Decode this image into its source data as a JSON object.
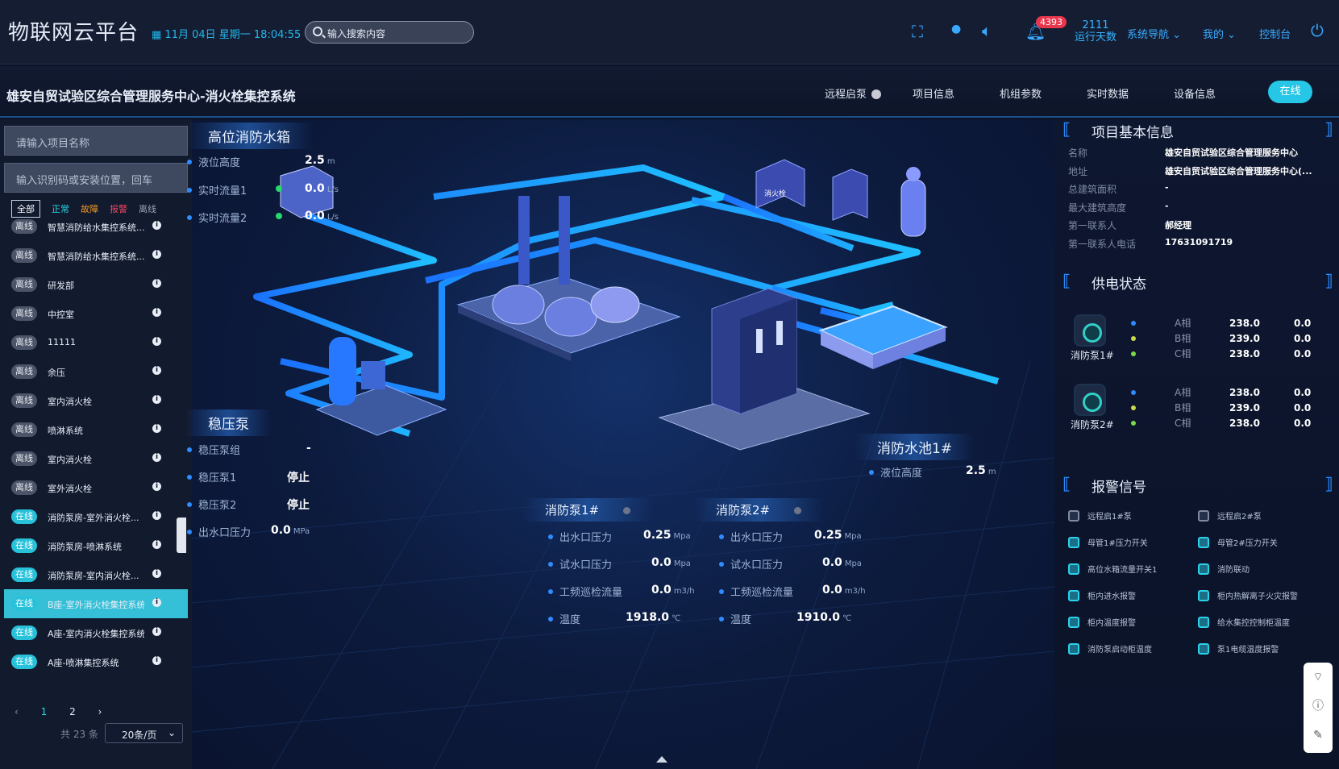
{
  "header": {
    "brand": "物联网云平台",
    "datetime": "11月 04日 星期一 18:04:55",
    "search_placeholder": "输入搜索内容",
    "notif_count": "4393",
    "run_days_value": "2111",
    "run_days_label": "运行天数",
    "nav_system": "系统导航",
    "nav_mine": "我的",
    "nav_console": "控制台"
  },
  "titlebar": {
    "system_title": "雄安自贸试验区综合管理服务中心-消火栓集控系统",
    "remote_start": "远程启泵",
    "tabs": [
      "项目信息",
      "机组参数",
      "实时数据",
      "设备信息"
    ],
    "online": "在线"
  },
  "sidebar": {
    "project_input": "请输入项目名称",
    "code_input": "输入识别码或安装位置，回车",
    "filters": [
      "全部",
      "正常",
      "故障",
      "报警",
      "离线"
    ],
    "items": [
      {
        "status": "离线",
        "name": "智慧消防给水集控系统..."
      },
      {
        "status": "离线",
        "name": "智慧消防给水集控系统..."
      },
      {
        "status": "离线",
        "name": "研发部"
      },
      {
        "status": "离线",
        "name": "中控室"
      },
      {
        "status": "离线",
        "name": "11111"
      },
      {
        "status": "离线",
        "name": "余压"
      },
      {
        "status": "离线",
        "name": "室内消火栓"
      },
      {
        "status": "离线",
        "name": "喷淋系统"
      },
      {
        "status": "离线",
        "name": "室内消火栓"
      },
      {
        "status": "离线",
        "name": "室外消火栓"
      },
      {
        "status": "在线",
        "name": "消防泵房-室外消火栓..."
      },
      {
        "status": "在线",
        "name": "消防泵房-喷淋系统"
      },
      {
        "status": "在线",
        "name": "消防泵房-室内消火栓..."
      },
      {
        "status": "在线",
        "name": "B座-室外消火栓集控系统"
      },
      {
        "status": "在线",
        "name": "A座-室内消火栓集控系统"
      },
      {
        "status": "在线",
        "name": "A座-喷淋集控系统"
      }
    ],
    "selected_index": 13,
    "pager": {
      "page1": "1",
      "page2": "2",
      "total": "共 23 条",
      "page_size": "20条/页"
    }
  },
  "scene": {
    "tank": {
      "title": "高位消防水箱",
      "level_label": "液位高度",
      "level_value": "2.5",
      "level_unit": "m",
      "flow1_label": "实时流量1",
      "flow1_value": "0.0",
      "flow1_unit": "L/s",
      "flow2_label": "实时流量2",
      "flow2_value": "0.0",
      "flow2_unit": "L/s"
    },
    "regulator": {
      "title": "稳压泵",
      "group_label": "稳压泵组",
      "group_value": "-",
      "p1_label": "稳压泵1",
      "p1_value": "停止",
      "p2_label": "稳压泵2",
      "p2_value": "停止",
      "outlet_label": "出水口压力",
      "outlet_value": "0.0",
      "outlet_unit": "MPa"
    },
    "pool": {
      "title": "消防水池1#",
      "level_label": "液位高度",
      "level_value": "2.5",
      "level_unit": "m"
    },
    "pump1": {
      "title": "消防泵1#",
      "rows": [
        [
          "出水口压力",
          "0.25",
          "Mpa"
        ],
        [
          "试水口压力",
          "0.0",
          "Mpa"
        ],
        [
          "工频巡检流量",
          "0.0",
          "m3/h"
        ],
        [
          "温度",
          "1918.0",
          "℃"
        ]
      ]
    },
    "pump2": {
      "title": "消防泵2#",
      "rows": [
        [
          "出水口压力",
          "0.25",
          "Mpa"
        ],
        [
          "试水口压力",
          "0.0",
          "Mpa"
        ],
        [
          "工频巡检流量",
          "0.0",
          "m3/h"
        ],
        [
          "温度",
          "1910.0",
          "℃"
        ]
      ]
    },
    "hydrant_box_text": "消火栓"
  },
  "right": {
    "info_title": "项目基本信息",
    "info": [
      [
        "名称",
        "雄安自贸试验区综合管理服务中心"
      ],
      [
        "地址",
        "雄安自贸试验区综合管理服务中心(..."
      ],
      [
        "总建筑面积",
        "-"
      ],
      [
        "最大建筑高度",
        "-"
      ],
      [
        "第一联系人",
        "郝经理"
      ],
      [
        "第一联系人电话",
        "17631091719"
      ]
    ],
    "power_title": "供电状态",
    "pumps": [
      {
        "name": "消防泵1#",
        "phases": [
          [
            "A相",
            "238.0",
            "0.0"
          ],
          [
            "B相",
            "239.0",
            "0.0"
          ],
          [
            "C相",
            "238.0",
            "0.0"
          ]
        ]
      },
      {
        "name": "消防泵2#",
        "phases": [
          [
            "A相",
            "238.0",
            "0.0"
          ],
          [
            "B相",
            "239.0",
            "0.0"
          ],
          [
            "C相",
            "238.0",
            "0.0"
          ]
        ]
      }
    ],
    "phase_colors": [
      "#2f8cff",
      "#c8d94a",
      "#7bd94a"
    ],
    "alarm_title": "报警信号",
    "alarms": [
      [
        "远程启1#泵",
        "远程启2#泵"
      ],
      [
        "母管1#压力开关",
        "母管2#压力开关"
      ],
      [
        "高位水箱流量开关1",
        "消防联动"
      ],
      [
        "柜内进水报警",
        "柜内热解离子火灾报警"
      ],
      [
        "柜内温度报警",
        "给水集控控制柜温度"
      ],
      [
        "消防泵启动柜温度",
        "泵1电缆温度报警"
      ]
    ]
  },
  "colors": {
    "accent": "#25c6e6",
    "pipe": "#1aa7ff",
    "alarm_red": "#e8364c"
  }
}
